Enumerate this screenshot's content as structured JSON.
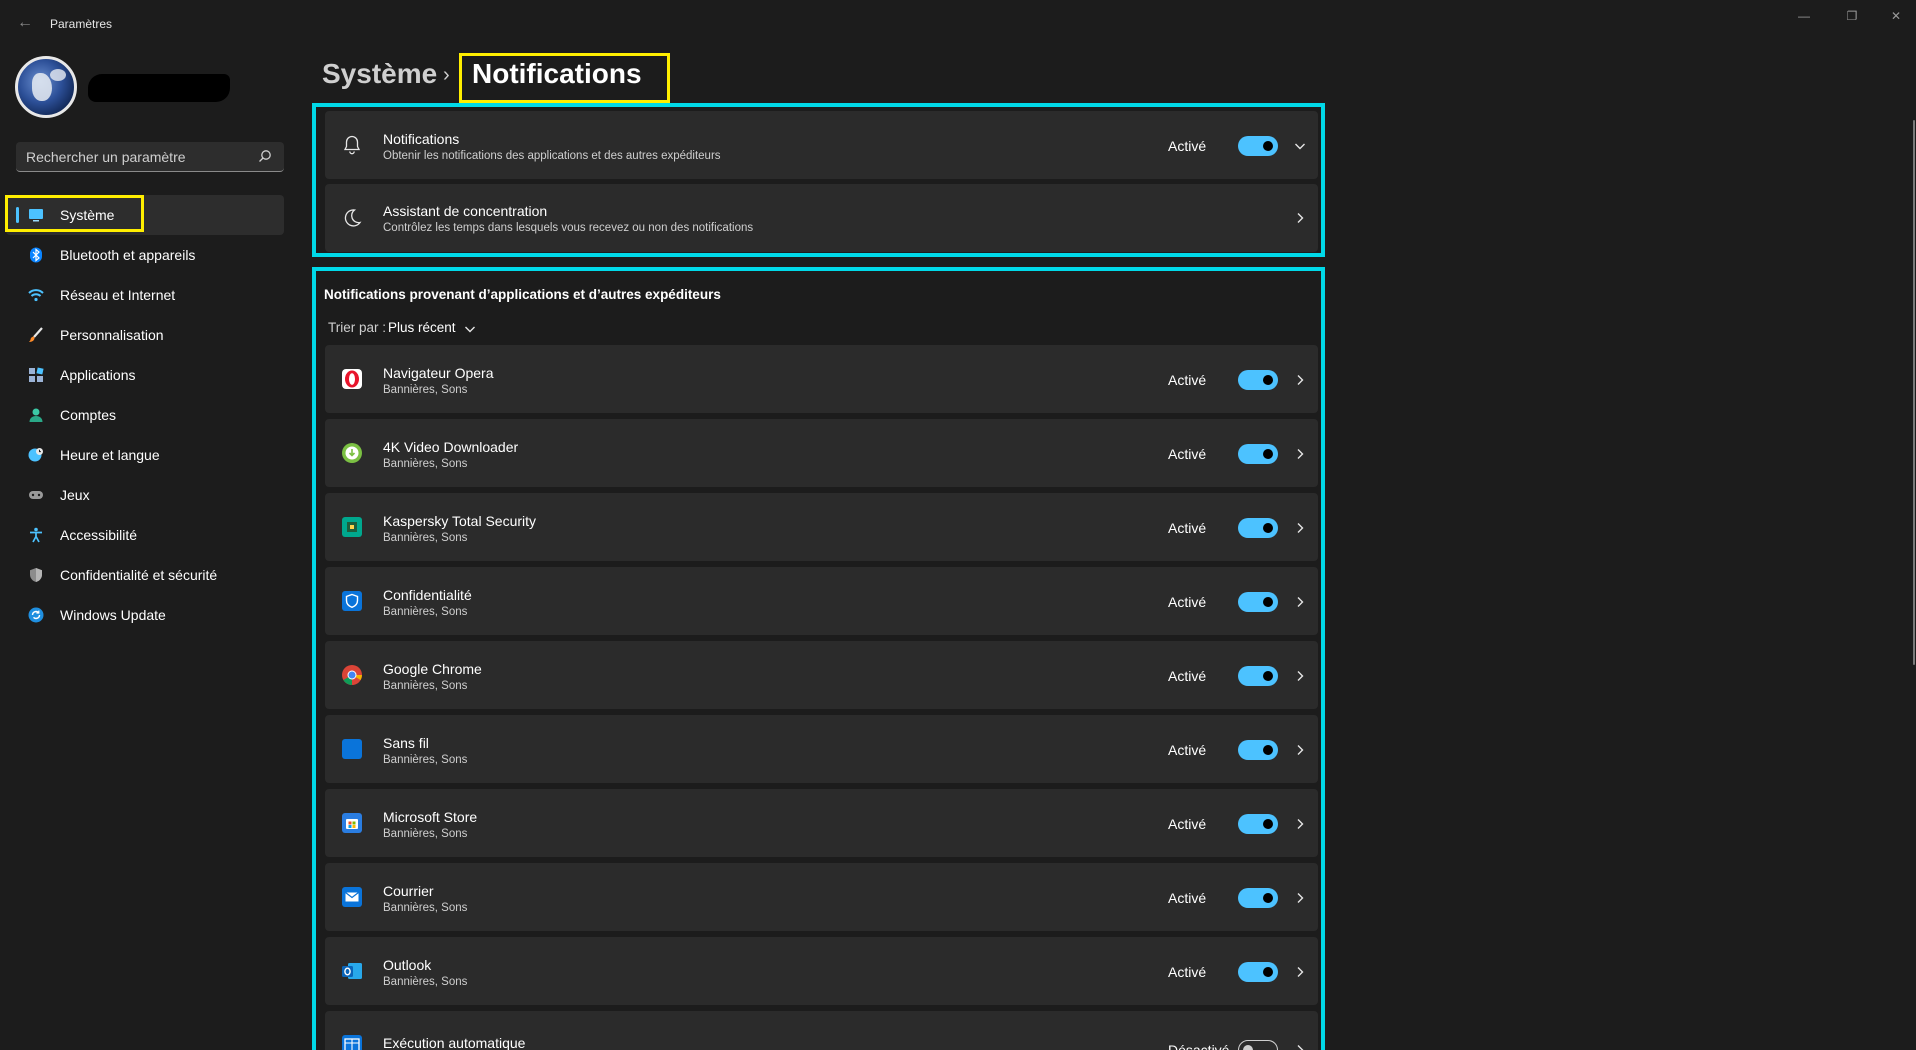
{
  "window": {
    "title": "Paramètres",
    "controls": [
      "minimize",
      "restore",
      "close"
    ]
  },
  "search": {
    "placeholder": "Rechercher un paramètre"
  },
  "sidebar": {
    "items": [
      {
        "label": "Système",
        "icon": "monitor-icon",
        "active": true
      },
      {
        "label": "Bluetooth et appareils",
        "icon": "bluetooth-icon"
      },
      {
        "label": "Réseau et Internet",
        "icon": "wifi-icon"
      },
      {
        "label": "Personnalisation",
        "icon": "brush-icon"
      },
      {
        "label": "Applications",
        "icon": "apps-icon"
      },
      {
        "label": "Comptes",
        "icon": "account-icon"
      },
      {
        "label": "Heure et langue",
        "icon": "globe-clock-icon"
      },
      {
        "label": "Jeux",
        "icon": "gamepad-icon"
      },
      {
        "label": "Accessibilité",
        "icon": "accessibility-icon"
      },
      {
        "label": "Confidentialité et sécurité",
        "icon": "shield-icon"
      },
      {
        "label": "Windows Update",
        "icon": "update-icon"
      }
    ]
  },
  "header": {
    "parent": "Système",
    "separator": "›",
    "current": "Notifications"
  },
  "top_cards": [
    {
      "title": "Notifications",
      "subtitle": "Obtenir les notifications des applications et des autres expéditeurs",
      "state": "Activé",
      "toggle": true,
      "chevron": "down",
      "icon": "bell-icon"
    },
    {
      "title": "Assistant de concentration",
      "subtitle": "Contrôlez les temps dans lesquels vous recevez ou non des notifications",
      "chevron": "right",
      "icon": "moon-icon"
    }
  ],
  "apps_section": {
    "title": "Notifications provenant d’applications et d’autres expéditeurs",
    "sort_label": "Trier par :",
    "sort_value": "Plus récent",
    "apps": [
      {
        "name": "Navigateur Opera",
        "sub": "Bannières, Sons",
        "state": "Activé",
        "on": true,
        "icon": "opera-icon"
      },
      {
        "name": "4K Video Downloader",
        "sub": "Bannières, Sons",
        "state": "Activé",
        "on": true,
        "icon": "4k-downloader-icon"
      },
      {
        "name": "Kaspersky Total Security",
        "sub": "Bannières, Sons",
        "state": "Activé",
        "on": true,
        "icon": "kaspersky-icon"
      },
      {
        "name": "Confidentialité",
        "sub": "Bannières, Sons",
        "state": "Activé",
        "on": true,
        "icon": "privacy-shield-icon"
      },
      {
        "name": "Google Chrome",
        "sub": "Bannières, Sons",
        "state": "Activé",
        "on": true,
        "icon": "chrome-icon"
      },
      {
        "name": "Sans fil",
        "sub": "Bannières, Sons",
        "state": "Activé",
        "on": true,
        "icon": "wireless-icon"
      },
      {
        "name": "Microsoft Store",
        "sub": "Bannières, Sons",
        "state": "Activé",
        "on": true,
        "icon": "store-icon"
      },
      {
        "name": "Courrier",
        "sub": "Bannières, Sons",
        "state": "Activé",
        "on": true,
        "icon": "mail-icon"
      },
      {
        "name": "Outlook",
        "sub": "Bannières, Sons",
        "state": "Activé",
        "on": true,
        "icon": "outlook-icon"
      },
      {
        "name": "Exécution automatique",
        "sub": "",
        "state": "Désactivé",
        "on": false,
        "icon": "autoplay-icon"
      }
    ]
  },
  "colors": {
    "background": "#1c1c1c",
    "card": "#2b2b2b",
    "accent": "#4cc2ff",
    "highlight_yellow": "#ffee00",
    "highlight_cyan": "#00d9e8"
  }
}
